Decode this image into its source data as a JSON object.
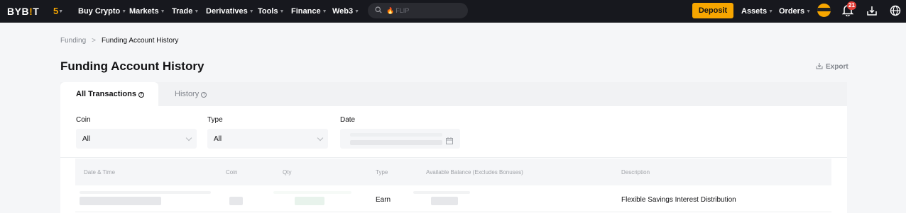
{
  "nav": {
    "logo_pre": "BYB",
    "logo_accent": "!",
    "logo_post": "T",
    "five_label": "5",
    "items": [
      "Buy Crypto",
      "Markets",
      "Trade",
      "Derivatives",
      "Tools",
      "Finance",
      "Web3"
    ],
    "search_placeholder": "FLIP",
    "deposit_label": "Deposit",
    "assets_label": "Assets",
    "orders_label": "Orders",
    "notification_count": "21"
  },
  "breadcrumb": {
    "parent": "Funding",
    "separator": ">",
    "current": "Funding Account History"
  },
  "page": {
    "title": "Funding Account History",
    "export_label": "Export"
  },
  "tabs": [
    {
      "label": "All Transactions"
    },
    {
      "label": "History"
    }
  ],
  "filters": {
    "coin_label": "Coin",
    "coin_value": "All",
    "type_label": "Type",
    "type_value": "All",
    "date_label": "Date"
  },
  "table": {
    "columns": [
      "Date & Time",
      "Coin",
      "Qty",
      "Type",
      "Available Balance (Excludes Bonuses)",
      "Description"
    ],
    "rows": [
      {
        "type": "Earn",
        "description": "Flexible Savings Interest Distribution"
      }
    ]
  },
  "colors": {
    "accent": "#f7a600",
    "topbar": "#17181e",
    "badge": "#e2413a"
  }
}
